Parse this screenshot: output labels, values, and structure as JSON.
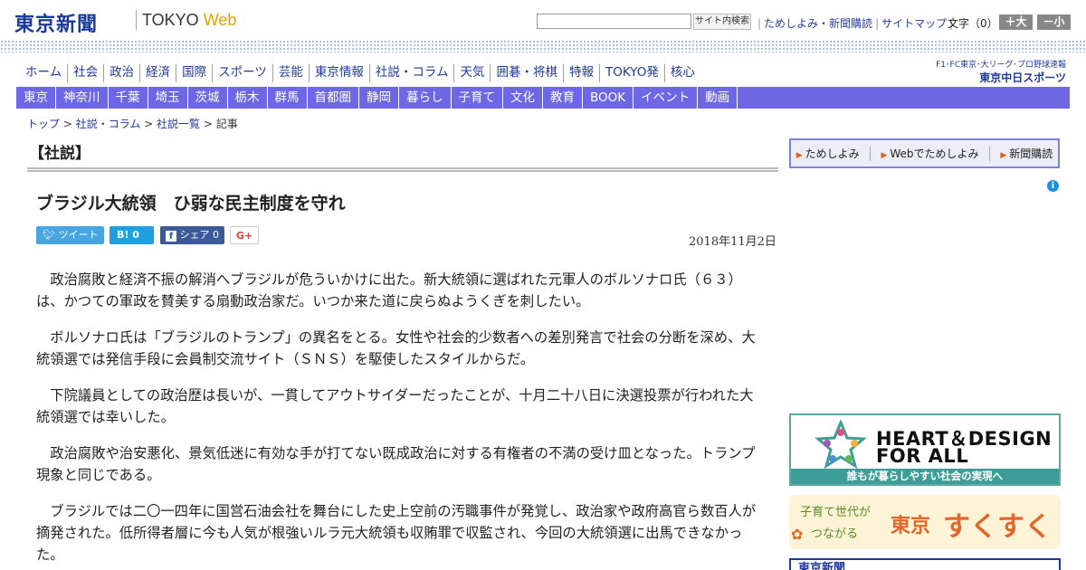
{
  "header": {
    "logo_jp": "東京新聞",
    "logo_en": "TOKYO",
    "logo_web": "Web",
    "search_button": "サイト内検索",
    "links": [
      "ためしよみ・新聞購読",
      "サイトマップ"
    ],
    "font_size_label": "文字（0）",
    "font_up": "＋大",
    "font_down": "－小"
  },
  "main_nav": [
    "ホーム",
    "社会",
    "政治",
    "経済",
    "国際",
    "スポーツ",
    "芸能",
    "東京情報",
    "社説・コラム",
    "天気",
    "囲碁・将棋",
    "特報",
    "TOKYO発",
    "核心"
  ],
  "sports_logo": {
    "line1": "F1･FC東京･大リーグ･プロ野球速報",
    "line2": "東京中日スポーツ"
  },
  "region_nav": [
    "東京",
    "神奈川",
    "千葉",
    "埼玉",
    "茨城",
    "栃木",
    "群馬",
    "首都圏",
    "静岡",
    "暮らし",
    "子育て",
    "文化",
    "教育",
    "BOOK",
    "イベント",
    "動画"
  ],
  "breadcrumb": {
    "items": [
      "トップ",
      "社説・コラム",
      "社説一覧"
    ],
    "current": "記事",
    "separator": " > "
  },
  "section_title": "【社説】",
  "article": {
    "title": "ブラジル大統領　ひ弱な民主制度を守れ",
    "date": "2018年11月2日",
    "share": {
      "tweet": "ツイート",
      "hatena": "B!",
      "hatena_count": "0",
      "facebook": "シェア",
      "facebook_count": "0",
      "gplus": "G+"
    },
    "paragraphs": [
      "政治腐敗と経済不振の解消へブラジルが危ういかけに出た。新大統領に選ばれた元軍人のボルソナロ氏（６３）は、かつての軍政を賛美する扇動政治家だ。いつか来た道に戻らぬようくぎを刺したい。",
      "ボルソナロ氏は「ブラジルのトランプ」の異名をとる。女性や社会的少数者への差別発言で社会の分断を深め、大統領選では発信手段に会員制交流サイト（ＳＮＳ）を駆使したスタイルからだ。",
      "下院議員としての政治歴は長いが、一貫してアウトサイダーだったことが、十月二十八日に決選投票が行われた大統領選では幸いした。",
      "政治腐敗や治安悪化、景気低迷に有効な手が打てない既成政治に対する有権者の不満の受け皿となった。トランプ現象と同じである。",
      "ブラジルでは二〇一四年に国営石油会社を舞台にした史上空前の汚職事件が発覚し、政治家や政府高官ら数百人が摘発された。低所得者層に今も人気が根強いルラ元大統領も収賄罪で収監され、今回の大統領選に出馬できなかった。"
    ]
  },
  "sidebar": {
    "subscribe": [
      "ためしよみ",
      "Webでためしよみ",
      "新聞購読"
    ],
    "info_icon": "i",
    "banner1": {
      "line1": "HEART＆DESIGN",
      "line2": "FOR ALL",
      "footer": "誰もが暮らしやすい社会の実現へ"
    },
    "banner2": {
      "sub1": "子育て世代が",
      "sub2": "つながる",
      "big1": "東京",
      "big2": "すくすく"
    },
    "banner3": {
      "text": "東京新聞"
    }
  },
  "colors": {
    "brand_blue": "#1f3a95",
    "region_nav_bg": "#6d67e6",
    "web_orange": "#e8a100",
    "twitter": "#47a6e2",
    "hatena": "#1d9fe0",
    "facebook": "#3b5a9a",
    "banner_teal": "#3e9d96",
    "sukusuku_orange": "#e0662b"
  }
}
